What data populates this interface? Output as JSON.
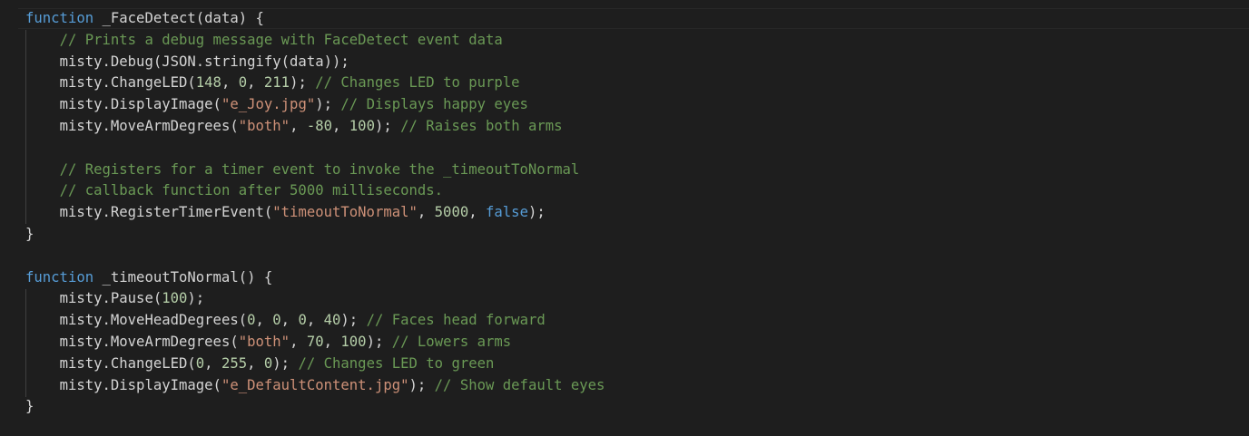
{
  "colors": {
    "background": "#1e1e1e",
    "keyword": "#569cd6",
    "text": "#d4d4d4",
    "number": "#b5cea8",
    "string": "#ce9178",
    "comment": "#6a9955",
    "boolean": "#569cd6"
  },
  "lines": [
    [
      [
        "kw",
        "function"
      ],
      [
        "ws",
        " "
      ],
      [
        "fn",
        "_FaceDetect"
      ],
      [
        "pun",
        "(data) {"
      ]
    ],
    [
      [
        "ws",
        "    "
      ],
      [
        "cmt",
        "// Prints a debug message with FaceDetect event data"
      ]
    ],
    [
      [
        "ws",
        "    "
      ],
      [
        "var",
        "misty.Debug(JSON.stringify(data));"
      ]
    ],
    [
      [
        "ws",
        "    "
      ],
      [
        "var",
        "misty.ChangeLED("
      ],
      [
        "num",
        "148"
      ],
      [
        "pun",
        ", "
      ],
      [
        "num",
        "0"
      ],
      [
        "pun",
        ", "
      ],
      [
        "num",
        "211"
      ],
      [
        "pun",
        "); "
      ],
      [
        "cmt",
        "// Changes LED to purple"
      ]
    ],
    [
      [
        "ws",
        "    "
      ],
      [
        "var",
        "misty.DisplayImage("
      ],
      [
        "str",
        "\"e_Joy.jpg\""
      ],
      [
        "pun",
        "); "
      ],
      [
        "cmt",
        "// Displays happy eyes"
      ]
    ],
    [
      [
        "ws",
        "    "
      ],
      [
        "var",
        "misty.MoveArmDegrees("
      ],
      [
        "str",
        "\"both\""
      ],
      [
        "pun",
        ", "
      ],
      [
        "num",
        "-80"
      ],
      [
        "pun",
        ", "
      ],
      [
        "num",
        "100"
      ],
      [
        "pun",
        "); "
      ],
      [
        "cmt",
        "// Raises both arms"
      ]
    ],
    [
      [
        "ws",
        ""
      ]
    ],
    [
      [
        "ws",
        "    "
      ],
      [
        "cmt",
        "// Registers for a timer event to invoke the _timeoutToNormal"
      ]
    ],
    [
      [
        "ws",
        "    "
      ],
      [
        "cmt",
        "// callback function after 5000 milliseconds."
      ]
    ],
    [
      [
        "ws",
        "    "
      ],
      [
        "var",
        "misty.RegisterTimerEvent("
      ],
      [
        "str",
        "\"timeoutToNormal\""
      ],
      [
        "pun",
        ", "
      ],
      [
        "num",
        "5000"
      ],
      [
        "pun",
        ", "
      ],
      [
        "bool",
        "false"
      ],
      [
        "pun",
        ");"
      ]
    ],
    [
      [
        "pun",
        "}"
      ]
    ],
    [
      [
        "ws",
        ""
      ]
    ],
    [
      [
        "kw",
        "function"
      ],
      [
        "ws",
        " "
      ],
      [
        "fn",
        "_timeoutToNormal"
      ],
      [
        "pun",
        "() {"
      ]
    ],
    [
      [
        "ws",
        "    "
      ],
      [
        "var",
        "misty.Pause("
      ],
      [
        "num",
        "100"
      ],
      [
        "pun",
        ");"
      ]
    ],
    [
      [
        "ws",
        "    "
      ],
      [
        "var",
        "misty.MoveHeadDegrees("
      ],
      [
        "num",
        "0"
      ],
      [
        "pun",
        ", "
      ],
      [
        "num",
        "0"
      ],
      [
        "pun",
        ", "
      ],
      [
        "num",
        "0"
      ],
      [
        "pun",
        ", "
      ],
      [
        "num",
        "40"
      ],
      [
        "pun",
        "); "
      ],
      [
        "cmt",
        "// Faces head forward"
      ]
    ],
    [
      [
        "ws",
        "    "
      ],
      [
        "var",
        "misty.MoveArmDegrees("
      ],
      [
        "str",
        "\"both\""
      ],
      [
        "pun",
        ", "
      ],
      [
        "num",
        "70"
      ],
      [
        "pun",
        ", "
      ],
      [
        "num",
        "100"
      ],
      [
        "pun",
        "); "
      ],
      [
        "cmt",
        "// Lowers arms"
      ]
    ],
    [
      [
        "ws",
        "    "
      ],
      [
        "var",
        "misty.ChangeLED("
      ],
      [
        "num",
        "0"
      ],
      [
        "pun",
        ", "
      ],
      [
        "num",
        "255"
      ],
      [
        "pun",
        ", "
      ],
      [
        "num",
        "0"
      ],
      [
        "pun",
        "); "
      ],
      [
        "cmt",
        "// Changes LED to green"
      ]
    ],
    [
      [
        "ws",
        "    "
      ],
      [
        "var",
        "misty.DisplayImage("
      ],
      [
        "str",
        "\"e_DefaultContent.jpg\""
      ],
      [
        "pun",
        "); "
      ],
      [
        "cmt",
        "// Show default eyes"
      ]
    ],
    [
      [
        "pun",
        "}"
      ]
    ]
  ]
}
